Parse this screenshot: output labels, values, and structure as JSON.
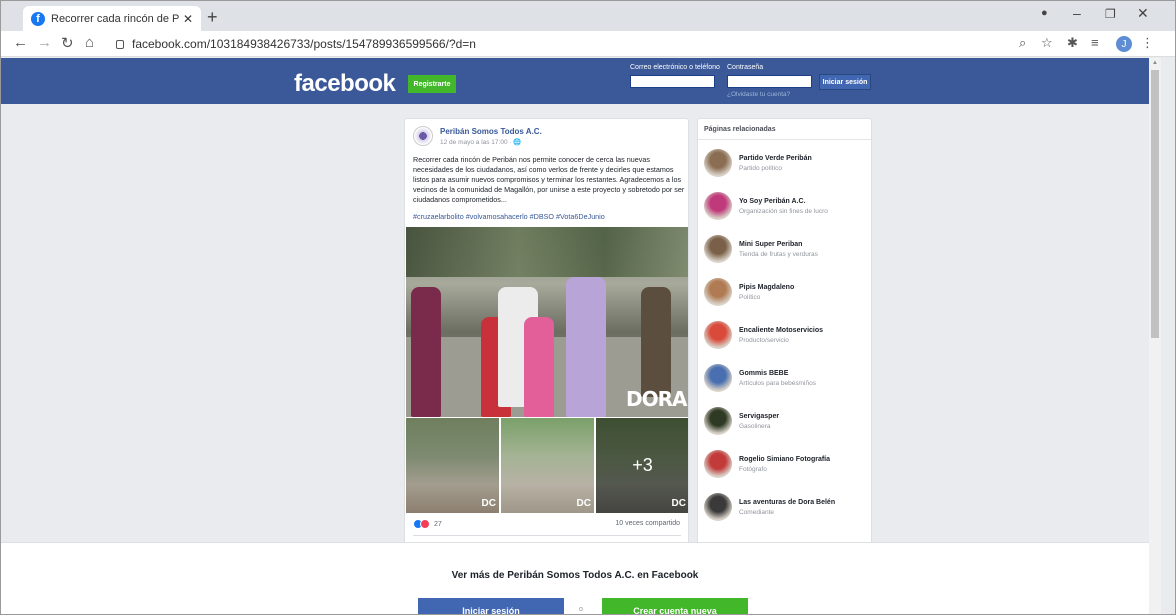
{
  "browser": {
    "tab_title": "Recorrer cada rincón de Peribán",
    "tab_close": "✕",
    "new_tab": "+",
    "url": "facebook.com/103184938426733/posts/154789936599566/?d=n",
    "profile_initial": "J",
    "icons": [
      "back-icon",
      "forward-icon",
      "reload-icon",
      "home-icon",
      "lock-icon",
      "zoom-icon",
      "star-icon",
      "extensions-icon",
      "reading-list-icon",
      "profile-icon",
      "menu-icon"
    ]
  },
  "header": {
    "logo": "facebook",
    "register_label": "Registrarte",
    "email_label": "Correo electrónico o teléfono",
    "password_label": "Contraseña",
    "login_label": "Iniciar sesión",
    "forgot_label": "¿Olvidaste tu cuenta?",
    "bg_color": "#3b5998"
  },
  "post": {
    "page_name": "Peribán Somos Todos A.C.",
    "date": "12 de mayo a las 17:00 · ",
    "text": "Recorrer cada rincón de Peribán nos permite conocer de cerca las nuevas necesidades de los ciudadanos, así como verlos de frente y decirles que estamos listos para asumir nuevos compromisos y terminar los restantes. Agradecemos a los vecinos de la comunidad de Magallón, por unirse a este proyecto y sobretodo por ser ciudadanos comprometidos...",
    "hashtags": "#cruzaelarbolito #volvamosahacerlo #DBSO #Vota6DeJunio",
    "watermark": "DORA",
    "thumb_watermark": "DC",
    "more_photos": "+3",
    "reaction_count": "27",
    "shares": "10 veces compartido"
  },
  "related": {
    "title": "Páginas relacionadas",
    "items": [
      {
        "name": "Partido Verde Peribán",
        "category": "Partido político",
        "color": "#8a6d52"
      },
      {
        "name": "Yo Soy Peribán A.C.",
        "category": "Organización sin fines de lucro",
        "color": "#c0397a"
      },
      {
        "name": "Mini Super Periban",
        "category": "Tienda de frutas y verduras",
        "color": "#7a6048"
      },
      {
        "name": "Pipis Magdaleno",
        "category": "Político",
        "color": "#b07a52"
      },
      {
        "name": "Encaliente Motoservicios",
        "category": "Producto/servicio",
        "color": "#d94a3a"
      },
      {
        "name": "Gommis BEBE",
        "category": "Artículos para bebés/niños",
        "color": "#4a6fb0"
      },
      {
        "name": "Servigasper",
        "category": "Gasolinera",
        "color": "#2f3a24"
      },
      {
        "name": "Rogelio Simiano Fotografía",
        "category": "Fotógrafo",
        "color": "#c23a3a"
      },
      {
        "name": "Las aventuras de Dora Belén",
        "category": "Comediante",
        "color": "#3a3a3a"
      }
    ]
  },
  "bottom": {
    "see_more": "Ver más de Peribán Somos Todos A.C. en Facebook",
    "login_label": "Iniciar sesión",
    "or_label": "o",
    "create_label": "Crear cuenta nueva"
  }
}
